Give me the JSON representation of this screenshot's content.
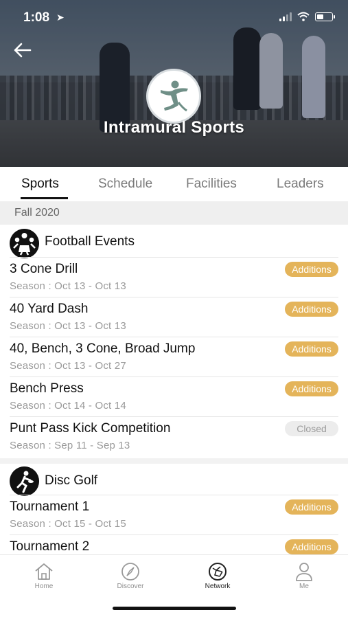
{
  "status_bar": {
    "time": "1:08",
    "location_arrow": "location-arrow-icon"
  },
  "header": {
    "title": "Intramural Sports",
    "back_icon": "back-arrow-icon"
  },
  "tabs": [
    {
      "label": "Sports",
      "active": true
    },
    {
      "label": "Schedule",
      "active": false
    },
    {
      "label": "Facilities",
      "active": false
    },
    {
      "label": "Leaders",
      "active": false
    }
  ],
  "season": "Fall 2020",
  "groups": [
    {
      "title": "Football Events",
      "icon": "football-icon",
      "events": [
        {
          "name": "3 Cone Drill",
          "season": "Season : Oct 13 - Oct 13",
          "status": "Additions"
        },
        {
          "name": "40 Yard Dash",
          "season": "Season : Oct 13 - Oct 13",
          "status": "Additions"
        },
        {
          "name": "40, Bench, 3 Cone, Broad Jump",
          "season": "Season : Oct 13 - Oct 27",
          "status": "Additions"
        },
        {
          "name": "Bench Press",
          "season": "Season : Oct 14 - Oct 14",
          "status": "Additions"
        },
        {
          "name": "Punt Pass Kick Competition",
          "season": "Season : Sep 11 - Sep 13",
          "status": "Closed"
        }
      ]
    },
    {
      "title": "Disc Golf",
      "icon": "disc-golf-icon",
      "events": [
        {
          "name": "Tournament 1",
          "season": "Season : Oct 15 - Oct 15",
          "status": "Additions"
        },
        {
          "name": "Tournament 2",
          "season": "",
          "status": "Additions"
        }
      ]
    }
  ],
  "bottom_nav": [
    {
      "label": "Home",
      "icon": "home-icon",
      "active": false
    },
    {
      "label": "Discover",
      "icon": "compass-icon",
      "active": false
    },
    {
      "label": "Network",
      "icon": "network-icon",
      "active": true
    },
    {
      "label": "Me",
      "icon": "user-icon",
      "active": false
    }
  ],
  "colors": {
    "additions_pill": "#e4b45a",
    "closed_pill": "#ececec",
    "active_tab": "#111111"
  }
}
